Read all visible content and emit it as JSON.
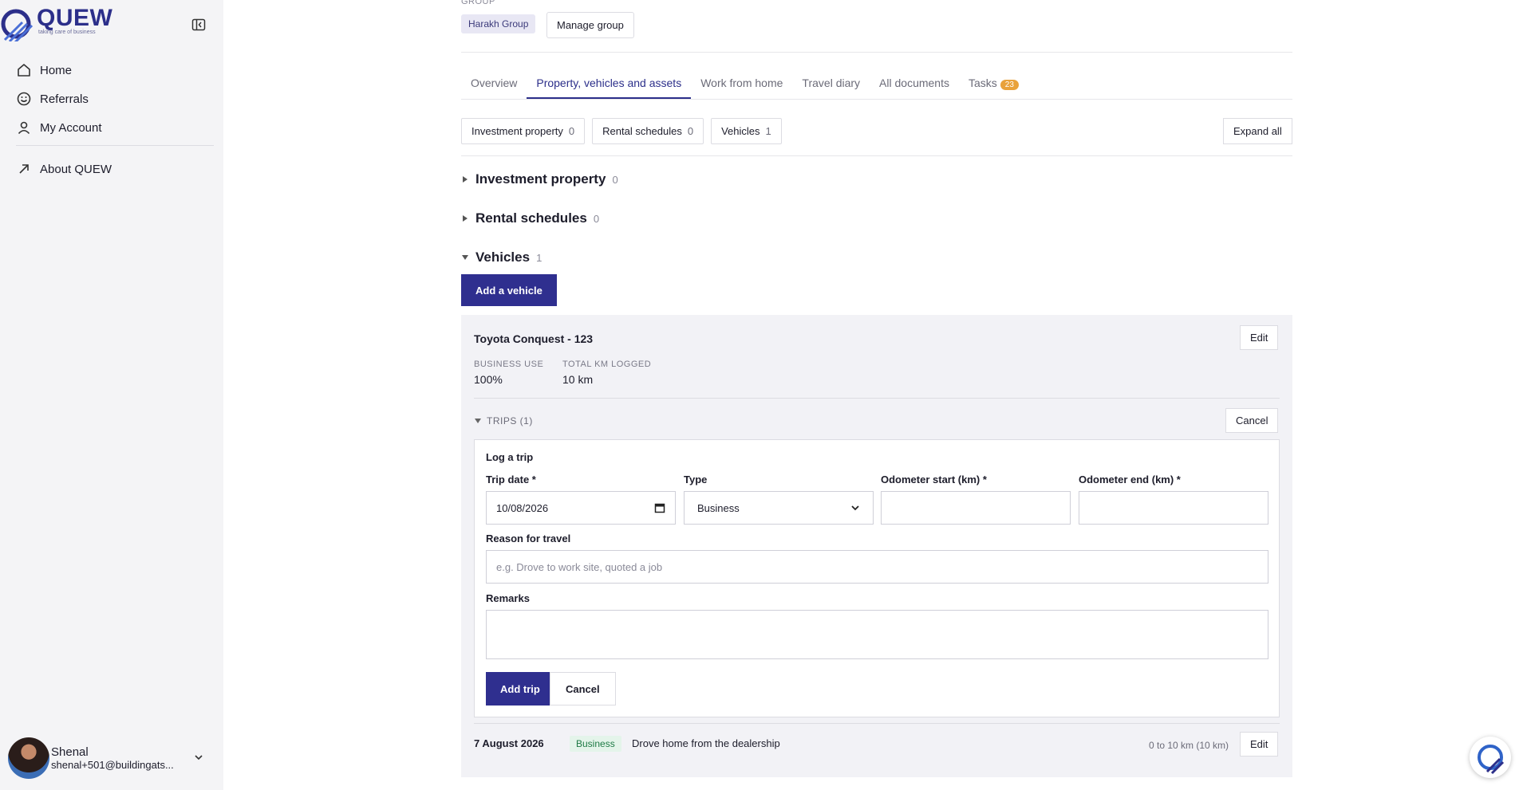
{
  "brand": {
    "name": "QUEW",
    "tagline": "taking care of business",
    "color": "#2c2f8a"
  },
  "sidebar": {
    "items": [
      {
        "label": "Home",
        "icon": "home-icon"
      },
      {
        "label": "Referrals",
        "icon": "smile-icon"
      },
      {
        "label": "My Account",
        "icon": "user-icon"
      }
    ],
    "secondary": [
      {
        "label": "About QUEW",
        "icon": "external-arrow-icon"
      }
    ],
    "user": {
      "name": "Shenal",
      "email": "shenal+501@buildingats..."
    }
  },
  "group": {
    "label": "GROUP",
    "name": "Harakh Group",
    "manage_label": "Manage group"
  },
  "tabs": [
    {
      "label": "Overview"
    },
    {
      "label": "Property, vehicles and assets",
      "active": true
    },
    {
      "label": "Work from home"
    },
    {
      "label": "Travel diary"
    },
    {
      "label": "All documents"
    },
    {
      "label": "Tasks",
      "badge": "23"
    }
  ],
  "chips": [
    {
      "label": "Investment property",
      "count": "0"
    },
    {
      "label": "Rental schedules",
      "count": "0"
    },
    {
      "label": "Vehicles",
      "count": "1"
    }
  ],
  "expand_all_label": "Expand all",
  "sections": {
    "investment": {
      "title": "Investment property",
      "count": "0",
      "expanded": false
    },
    "rental": {
      "title": "Rental schedules",
      "count": "0",
      "expanded": false
    },
    "vehicles": {
      "title": "Vehicles",
      "count": "1",
      "expanded": true
    }
  },
  "add_vehicle_label": "Add a vehicle",
  "vehicle": {
    "title": "Toyota Conquest - 123",
    "edit_label": "Edit",
    "business_use_label": "BUSINESS USE",
    "business_use_value": "100%",
    "total_km_label": "TOTAL KM LOGGED",
    "total_km_value": "10 km",
    "trips_header": "TRIPS (1)",
    "trips_cancel_label": "Cancel"
  },
  "trip_form": {
    "title": "Log a trip",
    "trip_date_label": "Trip date *",
    "trip_date_value": "10/08/2026",
    "type_label": "Type",
    "type_value": "Business",
    "odo_start_label": "Odometer start (km) *",
    "odo_end_label": "Odometer end (km) *",
    "reason_label": "Reason for travel",
    "reason_placeholder": "e.g. Drove to work site, quoted a job",
    "remarks_label": "Remarks",
    "add_label": "Add trip",
    "cancel_label": "Cancel"
  },
  "trip": {
    "date": "7 August 2026",
    "type": "Business",
    "reason": "Drove home from the dealership",
    "km": "0 to 10 km (10 km)",
    "edit_label": "Edit"
  }
}
